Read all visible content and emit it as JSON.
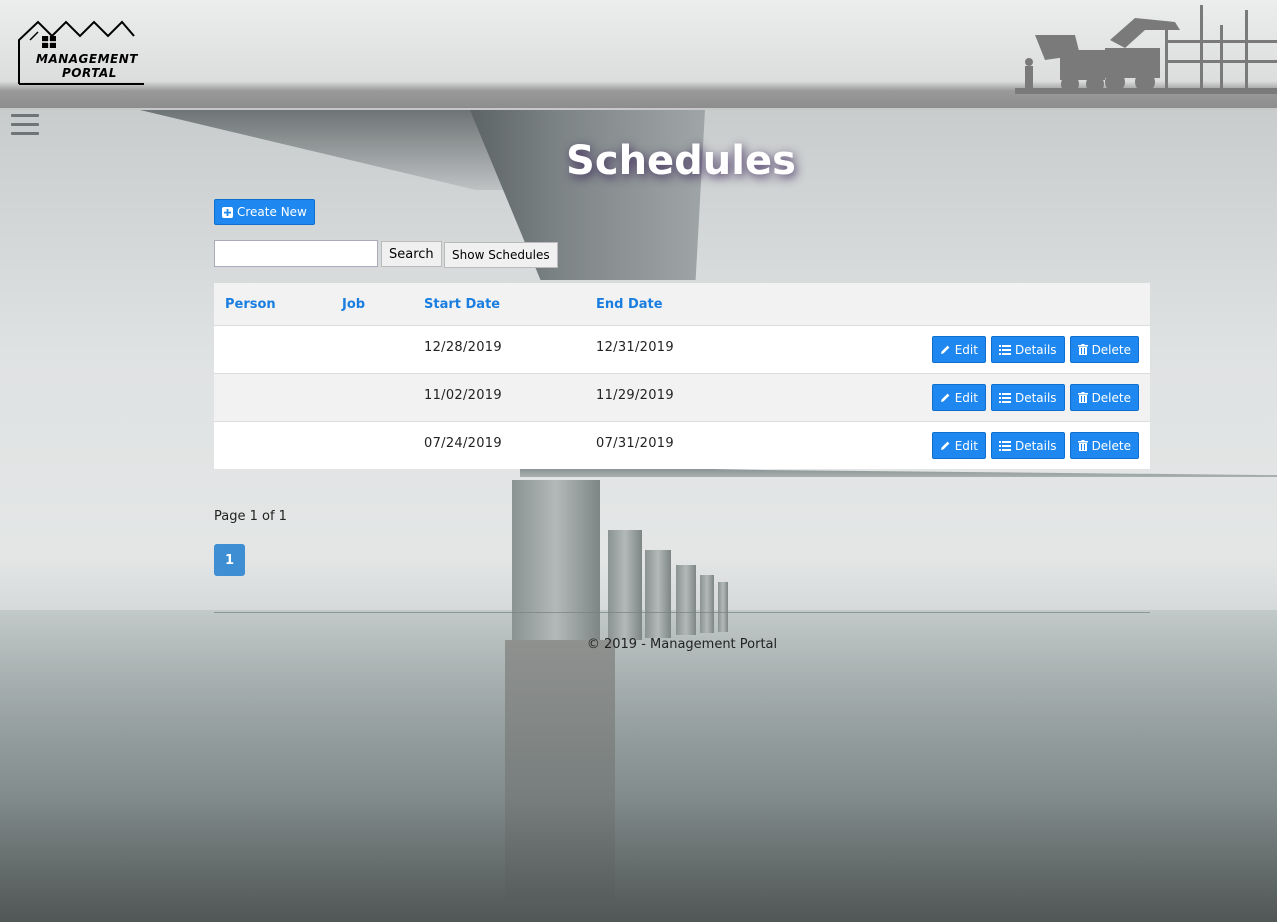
{
  "header": {
    "logo_line1": "MANAGEMENT",
    "logo_line2": "PORTAL"
  },
  "page": {
    "title": "Schedules",
    "create_label": "Create New",
    "search_placeholder": "",
    "search_label": "Search",
    "show_label": "Show Schedules"
  },
  "table": {
    "headers": [
      "Person",
      "Job",
      "Start Date",
      "End Date"
    ],
    "rows": [
      {
        "person": "",
        "job": "",
        "start": "12/28/2019",
        "end": "12/31/2019"
      },
      {
        "person": "",
        "job": "",
        "start": "11/02/2019",
        "end": "11/29/2019"
      },
      {
        "person": "",
        "job": "",
        "start": "07/24/2019",
        "end": "07/31/2019"
      }
    ],
    "edit_label": "Edit",
    "details_label": "Details",
    "delete_label": "Delete"
  },
  "pagination": {
    "info": "Page 1 of 1",
    "current": "1"
  },
  "footer": {
    "text": "© 2019 - Management Portal"
  },
  "colors": {
    "accent": "#1e88f0",
    "header_text": "#1a7ee0",
    "page_button": "#3d8ed3"
  },
  "icons": {
    "create": "plus-square-icon",
    "edit": "pencil-icon",
    "details": "list-icon",
    "delete": "trash-icon",
    "menu": "hamburger-icon"
  }
}
